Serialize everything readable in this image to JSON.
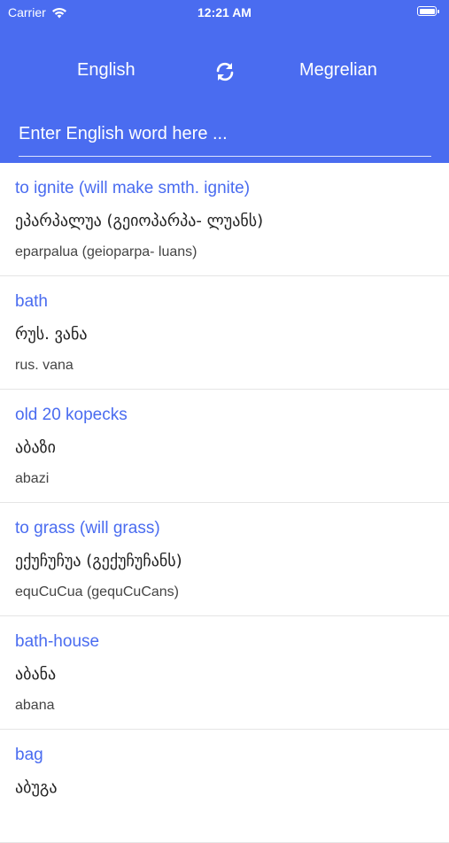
{
  "status_bar": {
    "carrier": "Carrier",
    "time": "12:21 AM",
    "battery_level": 1.0
  },
  "header": {
    "source_language": "English",
    "target_language": "Megrelian",
    "swap_icon": "swap-arrows-icon",
    "search_placeholder": "Enter English word here ...",
    "search_value": ""
  },
  "colors": {
    "accent": "#4a6cf0",
    "text": "#222222",
    "subtext": "#444444",
    "divider": "#e5e5e5"
  },
  "entries": [
    {
      "word": "to ignite (will make smth. ignite)",
      "translation": "ეპარპალუა (გეიოპარპა- ლუანს)",
      "transliteration": "eparpalua (geioparpa- luans)"
    },
    {
      "word": "bath",
      "translation": "რუს. ვანა",
      "transliteration": "rus. vana"
    },
    {
      "word": "old 20 kopecks",
      "translation": "აბაზი",
      "transliteration": "abazi"
    },
    {
      "word": "to grass (will grass)",
      "translation": "ექუჩუჩუა (გექუჩუჩანს)",
      "transliteration": "equCuCua (gequCuCans)"
    },
    {
      "word": "bath-house",
      "translation": "აბანა",
      "transliteration": "abana"
    },
    {
      "word": "bag",
      "translation": "აბუგა",
      "transliteration": ""
    }
  ]
}
